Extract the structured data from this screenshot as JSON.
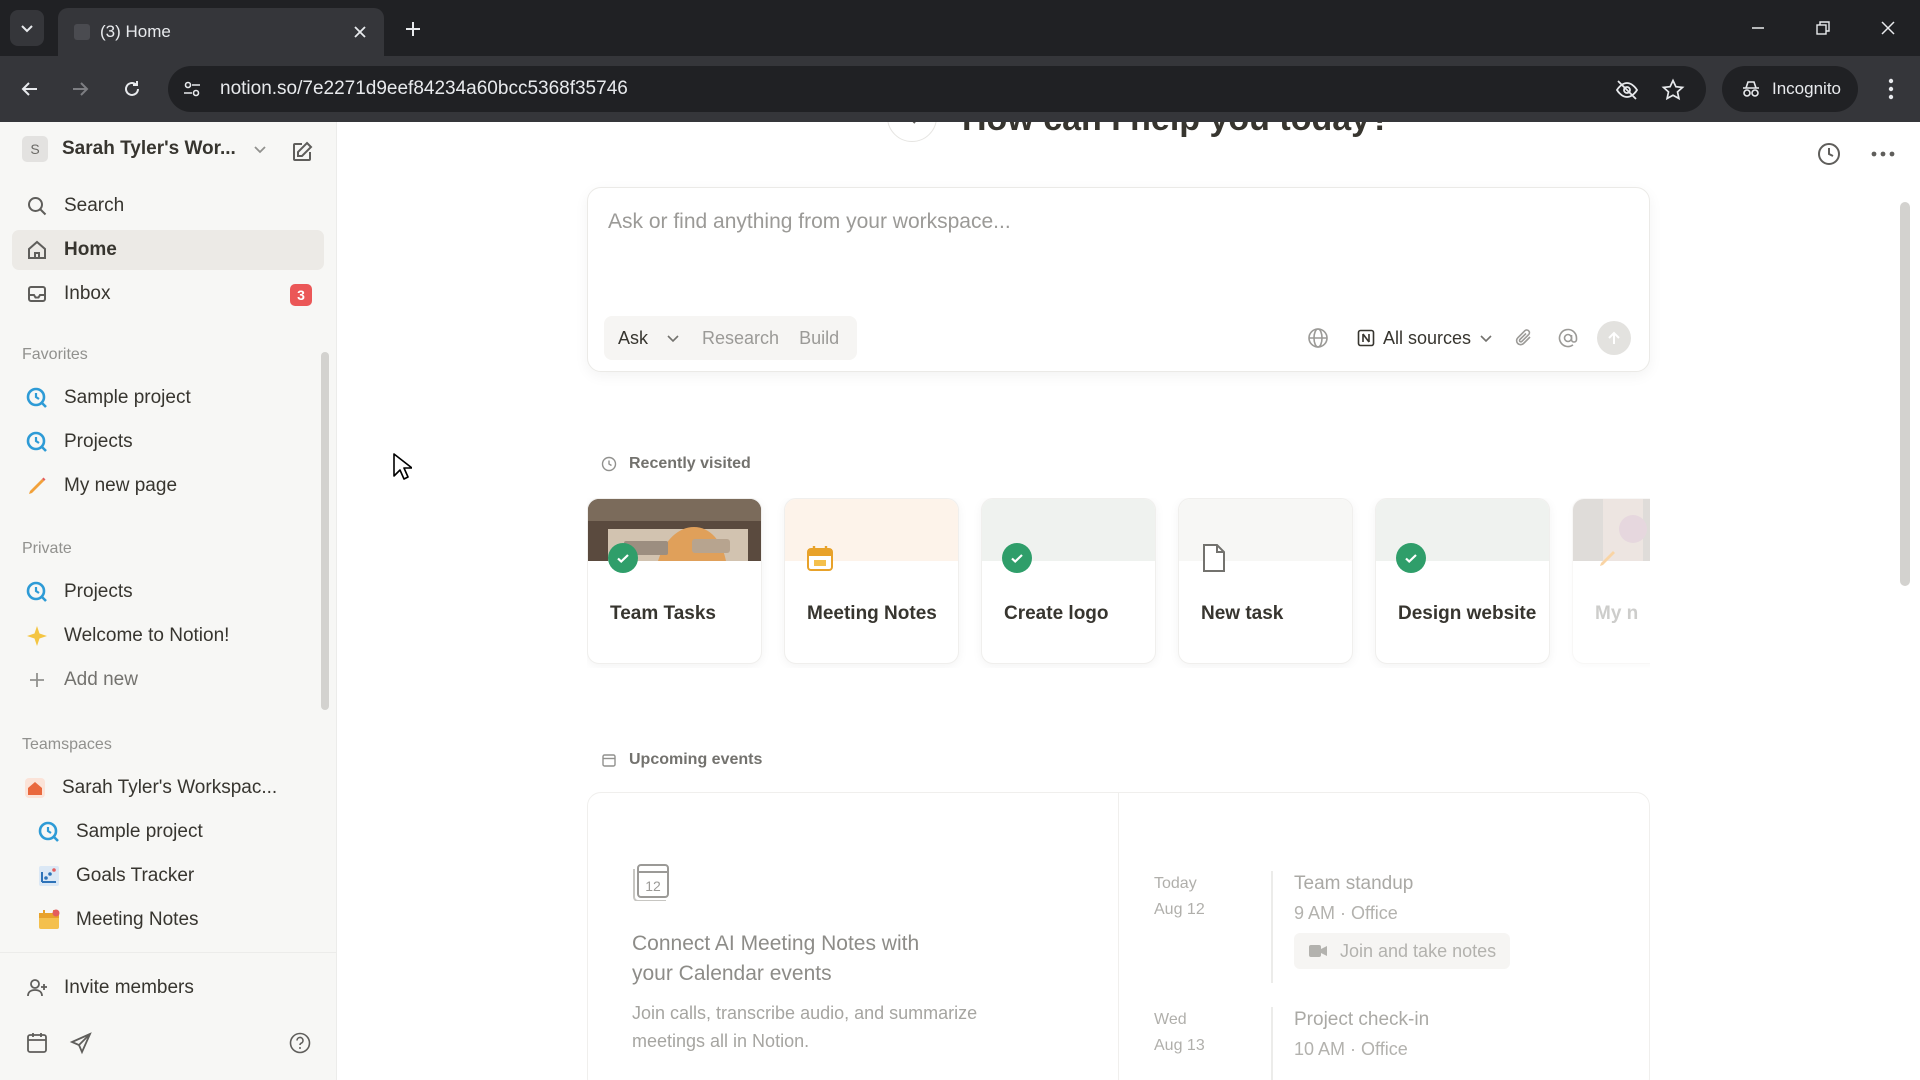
{
  "browser": {
    "tab_title": "(3) Home",
    "url": "notion.so/7e2271d9eef84234a60bcc5368f35746",
    "incognito_label": "Incognito"
  },
  "sidebar": {
    "workspace_initial": "S",
    "workspace_name": "Sarah Tyler's Wor...",
    "top_items": [
      {
        "label": "Search",
        "icon": "search-icon"
      },
      {
        "label": "Home",
        "icon": "home-icon",
        "active": true
      },
      {
        "label": "Inbox",
        "icon": "inbox-icon",
        "badge": "3"
      }
    ],
    "favorites_heading": "Favorites",
    "favorites": [
      {
        "label": "Sample project",
        "icon": "project-icon"
      },
      {
        "label": "Projects",
        "icon": "project-icon"
      },
      {
        "label": "My new page",
        "icon": "pencil-icon"
      }
    ],
    "private_heading": "Private",
    "private": [
      {
        "label": "Projects",
        "icon": "project-icon"
      },
      {
        "label": "Welcome to Notion!",
        "icon": "sparkle-icon"
      },
      {
        "label": "Add new",
        "icon": "plus-icon"
      }
    ],
    "teamspaces_heading": "Teamspaces",
    "teamspace_name": "Sarah Tyler's Workspac...",
    "teamspace_items": [
      {
        "label": "Sample project",
        "icon": "project-icon"
      },
      {
        "label": "Goals Tracker",
        "icon": "chart-icon"
      },
      {
        "label": "Meeting Notes",
        "icon": "calendar-icon"
      }
    ],
    "invite_label": "Invite members"
  },
  "main": {
    "hero_title": "How can I help you today?",
    "ask": {
      "placeholder": "Ask or find anything from your workspace...",
      "mode_selected": "Ask",
      "modes": [
        "Research",
        "Build"
      ],
      "sources_label": "All sources"
    },
    "recently_visited_label": "Recently visited",
    "recent": [
      {
        "title": "Team Tasks",
        "cover": "photo",
        "icon": "check-circle-icon"
      },
      {
        "title": "Meeting Notes",
        "cover": "#fdf3ea",
        "icon": "calendar-icon"
      },
      {
        "title": "Create logo",
        "cover": "#eff2ef",
        "icon": "check-circle-icon"
      },
      {
        "title": "New task",
        "cover": "#f7f7f5",
        "icon": "page-icon"
      },
      {
        "title": "Design website",
        "cover": "#eff2ef",
        "icon": "check-circle-icon"
      },
      {
        "title": "My n",
        "cover": "photo",
        "icon": "pencil-icon"
      }
    ],
    "upcoming_label": "Upcoming events",
    "calendar_icon_number": "12",
    "connect_title": "Connect AI Meeting Notes with your Calendar events",
    "connect_desc": "Join calls, transcribe audio, and summarize meetings all in Notion.",
    "events": [
      {
        "day": "Today",
        "date": "Aug 12",
        "title": "Team standup",
        "sub": "9 AM · Office",
        "action": "Join and take notes"
      },
      {
        "day": "Wed",
        "date": "Aug 13",
        "title": "Project check-in",
        "sub": "10 AM · Office"
      }
    ]
  },
  "colors": {
    "accent_green": "#2f9e6a",
    "badge_red": "#eb5757",
    "sidebar_bg": "#f7f7f5",
    "chrome_dark": "#202124"
  }
}
